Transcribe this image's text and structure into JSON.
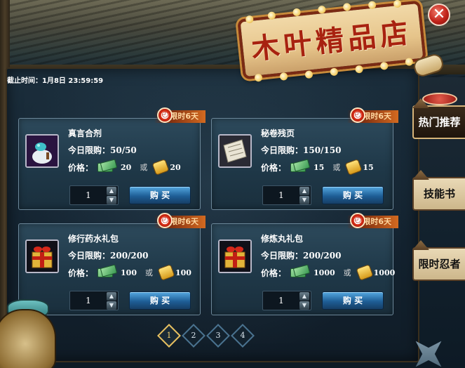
{
  "window": {
    "sign_title": "木叶精品店",
    "close_glyph": "✕",
    "deadline": "截止时间：1月8日 23:59:59"
  },
  "side_tabs": [
    {
      "label": "热门推荐",
      "active": true
    },
    {
      "label": "技能书",
      "active": false
    },
    {
      "label": "限时忍者",
      "active": false
    }
  ],
  "items": [
    {
      "badge": "限时6天",
      "name": "真言合剂",
      "limit": "今日限购：50/50",
      "price_label": "价格：",
      "price_cash": "20",
      "price_or": "或",
      "price_gold": "20",
      "quantity": "1",
      "buy_label": "购 买",
      "icon": "potion-bag-icon"
    },
    {
      "badge": "限时6天",
      "name": "秘卷残页",
      "limit": "今日限购：150/150",
      "price_label": "价格：",
      "price_cash": "15",
      "price_or": "或",
      "price_gold": "15",
      "quantity": "1",
      "buy_label": "购 买",
      "icon": "scroll-page-icon"
    },
    {
      "badge": "限时6天",
      "name": "修行药水礼包",
      "limit": "今日限购：200/200",
      "price_label": "价格：",
      "price_cash": "100",
      "price_or": "或",
      "price_gold": "100",
      "quantity": "1",
      "buy_label": "购 买",
      "icon": "gift-box-icon"
    },
    {
      "badge": "限时6天",
      "name": "修炼丸礼包",
      "limit": "今日限购：200/200",
      "price_label": "价格：",
      "price_cash": "1000",
      "price_or": "或",
      "price_gold": "1000",
      "quantity": "1",
      "buy_label": "购 买",
      "icon": "gift-box-icon"
    }
  ],
  "pagination": {
    "pages": [
      "1",
      "2",
      "3",
      "4"
    ],
    "current": "1"
  },
  "colors": {
    "sign_text": "#a82210",
    "buy_button": "#1e5e96",
    "active_page": "#e7c060",
    "badge": "#d36a20"
  }
}
